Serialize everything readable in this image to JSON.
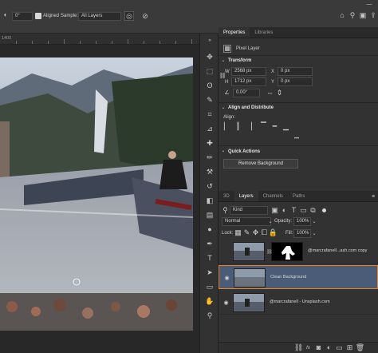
{
  "options_bar": {
    "size_value": "0°",
    "aligned_label": "Aligned",
    "sample_label": "Sample:",
    "sample_value": "All Layers",
    "icons": [
      "brush-preset-icon",
      "angle-icon",
      "ignore-adjustments-icon",
      "pressure-icon",
      "home-icon",
      "search-icon",
      "workspace-icon",
      "share-icon"
    ]
  },
  "ruler": {
    "first_label": "1400"
  },
  "properties": {
    "tabs": [
      "Properties",
      "Libraries"
    ],
    "layer_type": "Pixel Layer",
    "transform": {
      "title": "Transform",
      "w_label": "W",
      "w_value": "2568 px",
      "h_label": "H",
      "h_value": "1712 px",
      "x_label": "X",
      "x_value": "0 px",
      "y_label": "Y",
      "y_value": "0 px",
      "angle_value": "0.00°"
    },
    "align": {
      "title": "Align and Distribute",
      "align_label": "Align:"
    },
    "quick_actions": {
      "title": "Quick Actions",
      "remove_bg_label": "Remove Background"
    }
  },
  "layers": {
    "tabs": [
      "3D",
      "Layers",
      "Channels",
      "Paths"
    ],
    "kind_label": "Kind",
    "blend_mode": "Normal",
    "opacity_label": "Opacity:",
    "opacity_value": "100%",
    "lock_label": "Lock:",
    "fill_label": "Fill:",
    "fill_value": "100%",
    "items": [
      {
        "name": "@marcrafanell...ash.com copy",
        "visible": false,
        "selected": false,
        "has_mask": true
      },
      {
        "name": "Clean Background",
        "visible": true,
        "selected": true,
        "has_mask": false
      },
      {
        "name": "@marcrafanell - Unsplash.com",
        "visible": true,
        "selected": false,
        "has_mask": false
      }
    ],
    "bottom_icons": [
      "link-icon",
      "fx-icon",
      "mask-icon",
      "adjustment-icon",
      "group-icon",
      "new-layer-icon",
      "trash-icon"
    ],
    "bottom_fx_label": "fx"
  },
  "colors": {
    "selection_outline": "#e8862a",
    "selected_row": "#4a5c78",
    "accent": "#ffffff"
  }
}
